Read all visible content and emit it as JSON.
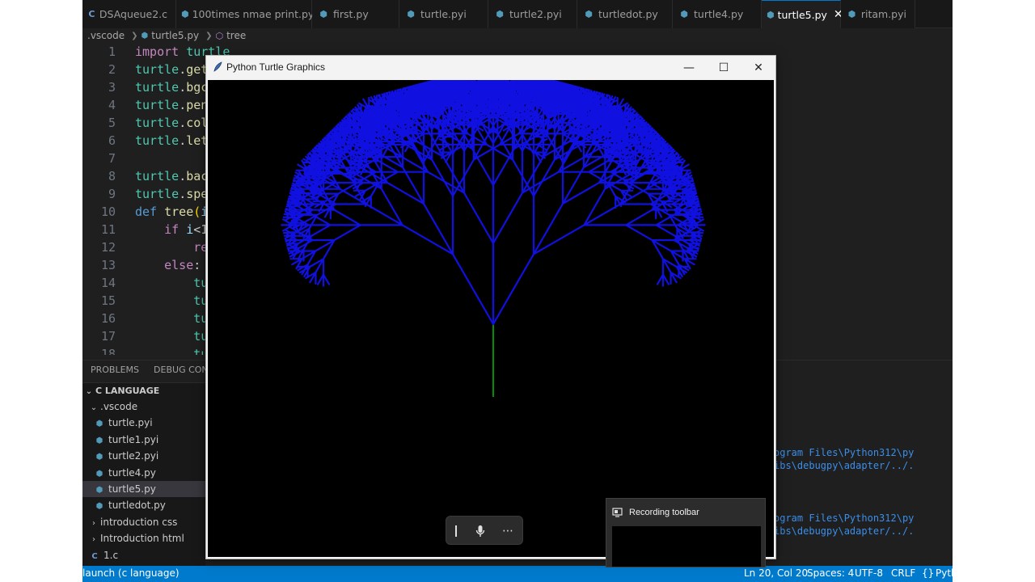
{
  "tabs": [
    {
      "icon": "C",
      "label": "DSAqueue2.c"
    },
    {
      "icon": "py",
      "label": "100times nmae print.py"
    },
    {
      "icon": "py",
      "label": "first.py"
    },
    {
      "icon": "py",
      "label": "turtle.pyi"
    },
    {
      "icon": "py",
      "label": "turtle2.pyi"
    },
    {
      "icon": "py",
      "label": "turtledot.py"
    },
    {
      "icon": "py",
      "label": "turtle4.py"
    },
    {
      "icon": "py",
      "label": "turtle5.py",
      "active": true,
      "close": "✕"
    },
    {
      "icon": "py",
      "label": "ritam.pyi"
    }
  ],
  "breadcrumb": {
    "folder": ".vscode",
    "file": "turtle5.py",
    "symbol": "tree"
  },
  "code": [
    {
      "n": "1",
      "parts": [
        [
          "kw",
          "import"
        ],
        [
          "",
          " "
        ],
        [
          "mod",
          "turtle"
        ]
      ]
    },
    {
      "n": "2",
      "parts": [
        [
          "mod",
          "turtle"
        ],
        [
          "",
          "."
        ],
        [
          "fn",
          "get"
        ]
      ]
    },
    {
      "n": "3",
      "parts": [
        [
          "mod",
          "turtle"
        ],
        [
          "",
          "."
        ],
        [
          "fn",
          "bgc"
        ]
      ]
    },
    {
      "n": "4",
      "parts": [
        [
          "mod",
          "turtle"
        ],
        [
          "",
          "."
        ],
        [
          "fn",
          "pen"
        ]
      ]
    },
    {
      "n": "5",
      "parts": [
        [
          "mod",
          "turtle"
        ],
        [
          "",
          "."
        ],
        [
          "fn",
          "col"
        ]
      ]
    },
    {
      "n": "6",
      "parts": [
        [
          "mod",
          "turtle"
        ],
        [
          "",
          "."
        ],
        [
          "fn",
          "let"
        ]
      ]
    },
    {
      "n": "7",
      "parts": []
    },
    {
      "n": "8",
      "parts": [
        [
          "mod",
          "turtle"
        ],
        [
          "",
          "."
        ],
        [
          "fn",
          "bac"
        ]
      ]
    },
    {
      "n": "9",
      "parts": [
        [
          "mod",
          "turtle"
        ],
        [
          "",
          "."
        ],
        [
          "fn",
          "spe"
        ]
      ]
    },
    {
      "n": "10",
      "parts": [
        [
          "kw2",
          "def"
        ],
        [
          "",
          " "
        ],
        [
          "fn",
          "tree"
        ],
        [
          "par",
          "("
        ],
        [
          "id",
          "i"
        ]
      ]
    },
    {
      "n": "11",
      "parts": [
        [
          "",
          "    "
        ],
        [
          "kw",
          "if"
        ],
        [
          "",
          " "
        ],
        [
          "id",
          "i"
        ],
        [
          "",
          "<1"
        ]
      ]
    },
    {
      "n": "12",
      "parts": [
        [
          "",
          "        "
        ],
        [
          "kw",
          "re"
        ]
      ]
    },
    {
      "n": "13",
      "parts": [
        [
          "",
          "    "
        ],
        [
          "kw",
          "else"
        ],
        [
          "",
          ":"
        ]
      ]
    },
    {
      "n": "14",
      "parts": [
        [
          "",
          "        "
        ],
        [
          "mod",
          "tu"
        ]
      ]
    },
    {
      "n": "15",
      "parts": [
        [
          "",
          "        "
        ],
        [
          "mod",
          "tu"
        ]
      ]
    },
    {
      "n": "16",
      "parts": [
        [
          "",
          "        "
        ],
        [
          "mod",
          "tu"
        ]
      ]
    },
    {
      "n": "17",
      "parts": [
        [
          "",
          "        "
        ],
        [
          "mod",
          "tu"
        ]
      ]
    },
    {
      "n": "18",
      "parts": [
        [
          "",
          "        "
        ],
        [
          "mod",
          "tu"
        ]
      ]
    }
  ],
  "panel_tabs": [
    "PROBLEMS",
    "DEBUG CONSO"
  ],
  "explorer": {
    "section": "C LANGUAGE",
    "folder": ".vscode",
    "files": [
      "turtle.pyi",
      "turtle1.pyi",
      "turtle2.pyi",
      "turtle4.py",
      "turtle5.py",
      "turtledot.py"
    ],
    "selected": "turtle5.py",
    "folders": [
      "introduction css",
      "Introduction html"
    ],
    "other": "1.c"
  },
  "terminal_lines": [
    "ogram Files\\Python312\\py",
    "ibs\\debugpy\\adapter/../.",
    "ogram Files\\Python312\\py",
    "ibs\\debugpy\\adapter/../."
  ],
  "status": {
    "launch": "launch (c language)",
    "position": "Ln 20, Col 20",
    "spaces": "Spaces: 4",
    "encoding": "UTF-8",
    "eol": "CRLF",
    "lang": "Pyth"
  },
  "turtle_window": {
    "title": "Python Turtle Graphics",
    "minimize": "—",
    "maximize": "☐",
    "close": "✕"
  },
  "recording": {
    "popup_title": "Recording toolbar"
  },
  "colors": {
    "branch": "#1010e0",
    "trunk": "#00c000",
    "accent": "#007acc"
  }
}
